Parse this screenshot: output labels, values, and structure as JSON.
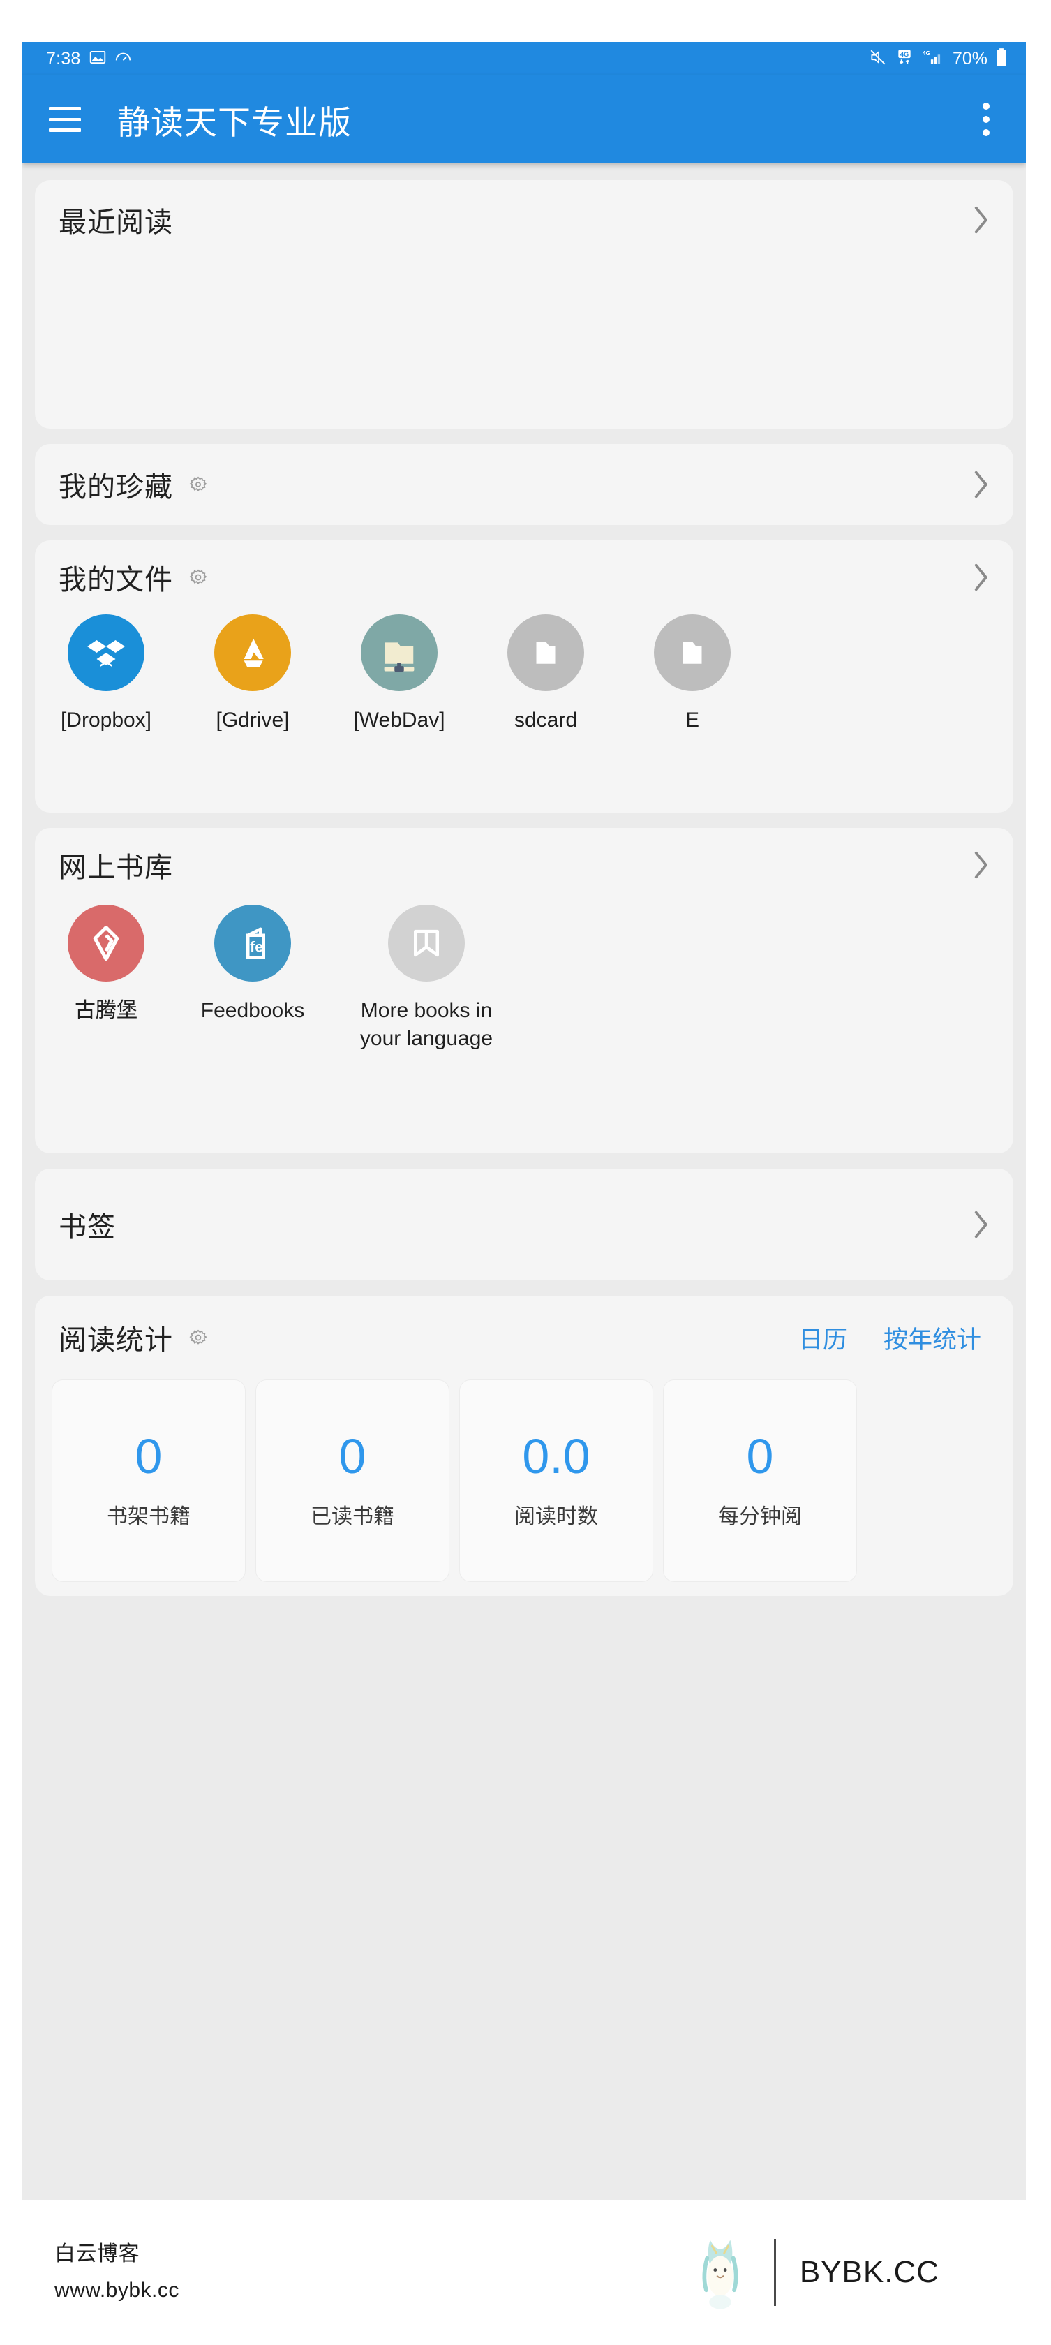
{
  "statusbar": {
    "time": "7:38",
    "battery_percent": "70%",
    "icons": [
      "image-icon",
      "wifi-meter-icon",
      "mute-icon",
      "4g-data-icon",
      "4g-signal-icon",
      "battery-icon"
    ]
  },
  "appbar": {
    "title": "静读天下专业版",
    "menu_icon": "hamburger-icon",
    "overflow_icon": "more-vertical-icon",
    "accent_color": "#2089e0"
  },
  "sections": {
    "recent": {
      "title": "最近阅读",
      "chevron": "chevron-right-icon"
    },
    "favorites": {
      "title": "我的珍藏",
      "gear": "gear-icon",
      "chevron": "chevron-right-icon"
    },
    "files": {
      "title": "我的文件",
      "gear": "gear-icon",
      "chevron": "chevron-right-icon",
      "items": [
        {
          "label": "[Dropbox]",
          "icon": "dropbox-icon",
          "color": "#1a8fd8"
        },
        {
          "label": "[Gdrive]",
          "icon": "gdrive-icon",
          "color": "#e9a21a"
        },
        {
          "label": "[WebDav]",
          "icon": "webdav-icon",
          "color": "#7fa8a6"
        },
        {
          "label": "sdcard",
          "icon": "folder-icon",
          "color": "#bdbdbd"
        },
        {
          "label": "E",
          "icon": "folder-icon",
          "color": "#bdbdbd"
        }
      ]
    },
    "online": {
      "title": "网上书库",
      "chevron": "chevron-right-icon",
      "items": [
        {
          "label": "古腾堡",
          "icon": "gutenberg-icon",
          "color": "#d96a6a"
        },
        {
          "label": "Feedbooks",
          "icon": "feedbooks-icon",
          "color": "#3f96c4"
        },
        {
          "label": "More books in\nyour language",
          "icon": "open-book-icon",
          "color": "#d2d2d2"
        }
      ]
    },
    "bookmarks": {
      "title": "书签",
      "chevron": "chevron-right-icon"
    },
    "stats": {
      "title": "阅读统计",
      "gear": "gear-icon",
      "links": [
        "日历",
        "按年统计"
      ],
      "link_color": "#2f8ee0",
      "boxes": [
        {
          "value": "0",
          "label": "书架书籍"
        },
        {
          "value": "0",
          "label": "已读书籍"
        },
        {
          "value": "0.0",
          "label": "阅读时数"
        },
        {
          "value": "0",
          "label": "每分钟阅"
        }
      ]
    }
  },
  "watermark": {
    "name": "白云博客",
    "url": "www.bybk.cc",
    "brand": "BYBK.CC",
    "mascot": "mascot-icon"
  }
}
